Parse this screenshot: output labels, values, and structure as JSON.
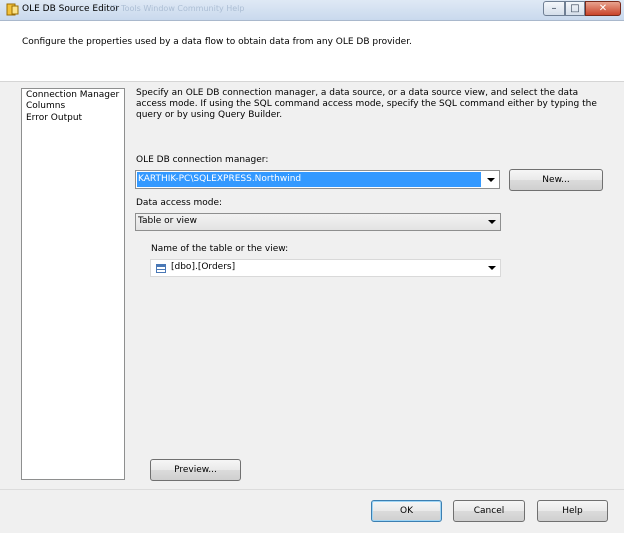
{
  "window": {
    "title": "OLE DB Source Editor",
    "ghost_menu": "ID    Tools    Window    Community    Help",
    "min_glyph": "–",
    "max_glyph": "□",
    "close_glyph": "✕"
  },
  "header": {
    "description": "Configure the properties used by a data flow to obtain data from any OLE DB provider."
  },
  "nav": {
    "items": [
      "Connection Manager",
      "Columns",
      "Error Output"
    ]
  },
  "main": {
    "description": "Specify an OLE DB connection manager, a data source, or a data source view, and select the data access mode. If using the SQL command access mode, specify the SQL command either by typing the query or by using Query Builder.",
    "connection_label": "OLE DB connection manager:",
    "connection_value": "KARTHIK-PC\\SQLEXPRESS.Northwind",
    "new_button": "New...",
    "access_mode_label": "Data access mode:",
    "access_mode_value": "Table or view",
    "table_label": "Name of the table or the view:",
    "table_value": "[dbo].[Orders]",
    "preview_button": "Preview..."
  },
  "footer": {
    "ok": "OK",
    "cancel": "Cancel",
    "help": "Help"
  },
  "colors": {
    "selection": "#3399ff",
    "titlebar": "#dfe9f5"
  }
}
